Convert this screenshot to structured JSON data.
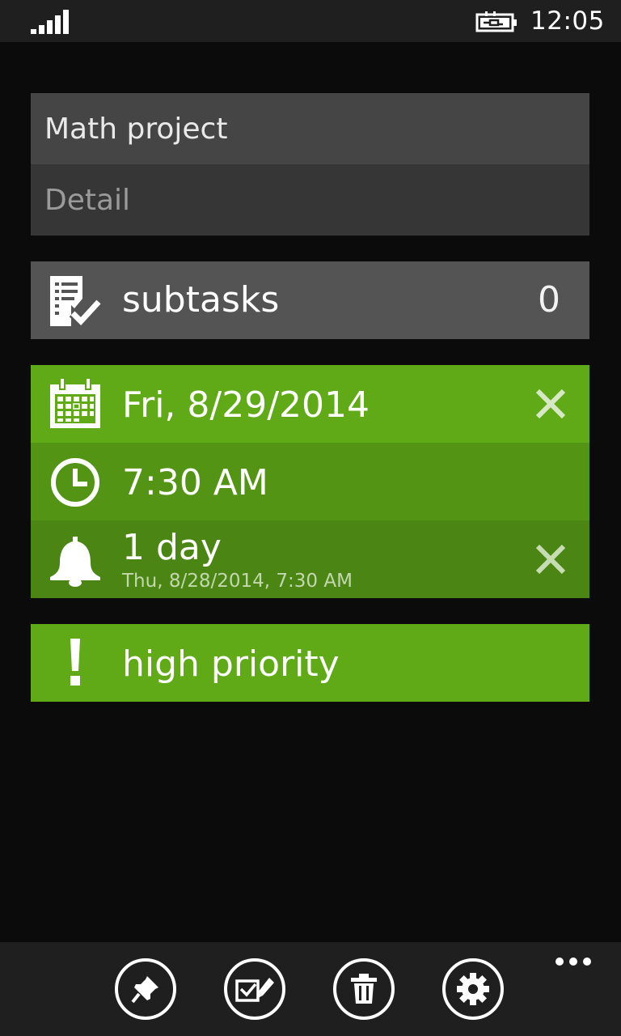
{
  "status": {
    "time": "12:05",
    "signal_icon": "signal-icon",
    "battery_icon": "battery-charging-icon"
  },
  "task": {
    "title": "Math project",
    "detail_placeholder": "Detail"
  },
  "subtasks": {
    "label": "subtasks",
    "count": "0",
    "icon": "checklist-icon"
  },
  "due": {
    "date": "Fri, 8/29/2014",
    "time": "7:30 AM",
    "date_icon": "calendar-icon",
    "time_icon": "clock-icon"
  },
  "reminder": {
    "label": "1 day",
    "detail": "Thu, 8/28/2014, 7:30 AM",
    "icon": "bell-icon"
  },
  "priority": {
    "label": "high priority",
    "icon": "exclamation-icon"
  },
  "appbar": {
    "buttons": [
      "pin-icon",
      "mark-complete-icon",
      "delete-icon",
      "settings-icon"
    ],
    "more": "more-icon"
  },
  "colors": {
    "accent": "#60a917",
    "accent_mid": "#549415",
    "accent_dark": "#4b8514",
    "background": "#0b0b0b"
  }
}
